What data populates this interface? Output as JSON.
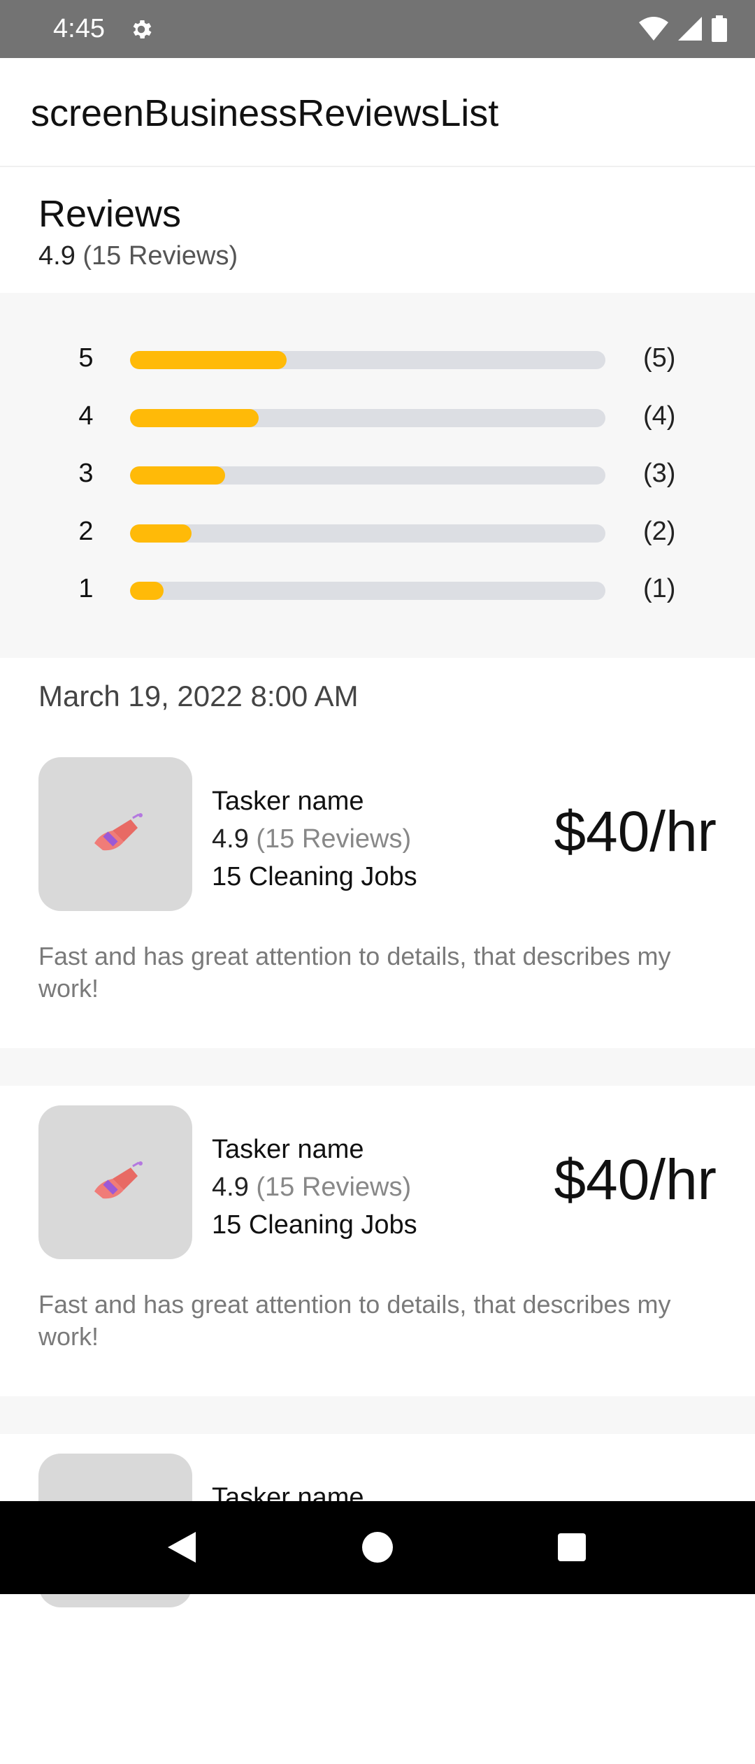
{
  "status_bar": {
    "time": "4:45",
    "icons": [
      "gear-icon",
      "wifi-icon",
      "signal-icon",
      "battery-icon"
    ]
  },
  "app_bar": {
    "title": "screenBusinessReviewsList"
  },
  "reviews": {
    "title": "Reviews",
    "rating": "4.9",
    "count_text": "(15 Reviews)",
    "distribution": [
      {
        "stars": "5",
        "count_text": "(5)",
        "fraction": 0.33
      },
      {
        "stars": "4",
        "count_text": "(4)",
        "fraction": 0.27
      },
      {
        "stars": "3",
        "count_text": "(3)",
        "fraction": 0.2
      },
      {
        "stars": "2",
        "count_text": "(2)",
        "fraction": 0.13
      },
      {
        "stars": "1",
        "count_text": "(1)",
        "fraction": 0.07
      }
    ]
  },
  "date": "March 19, 2022 8:00 AM",
  "review_cards": [
    {
      "name": "Tasker name",
      "rating": "4.9",
      "reviews_text": "(15 Reviews)",
      "jobs": "15 Cleaning Jobs",
      "price": "$40/hr",
      "comment": "Fast and has great attention to details, that describes my work!",
      "thumbnail_icon": "brush-icon"
    },
    {
      "name": "Tasker name",
      "rating": "4.9",
      "reviews_text": "(15 Reviews)",
      "jobs": "15 Cleaning Jobs",
      "price": "$40/hr",
      "comment": "Fast and has great attention to details, that describes my work!",
      "thumbnail_icon": "brush-icon"
    },
    {
      "name": "Tasker name"
    }
  ],
  "colors": {
    "bar_fill": "#ffba08",
    "bar_track": "#dcdee3",
    "status_bar": "#737373"
  }
}
